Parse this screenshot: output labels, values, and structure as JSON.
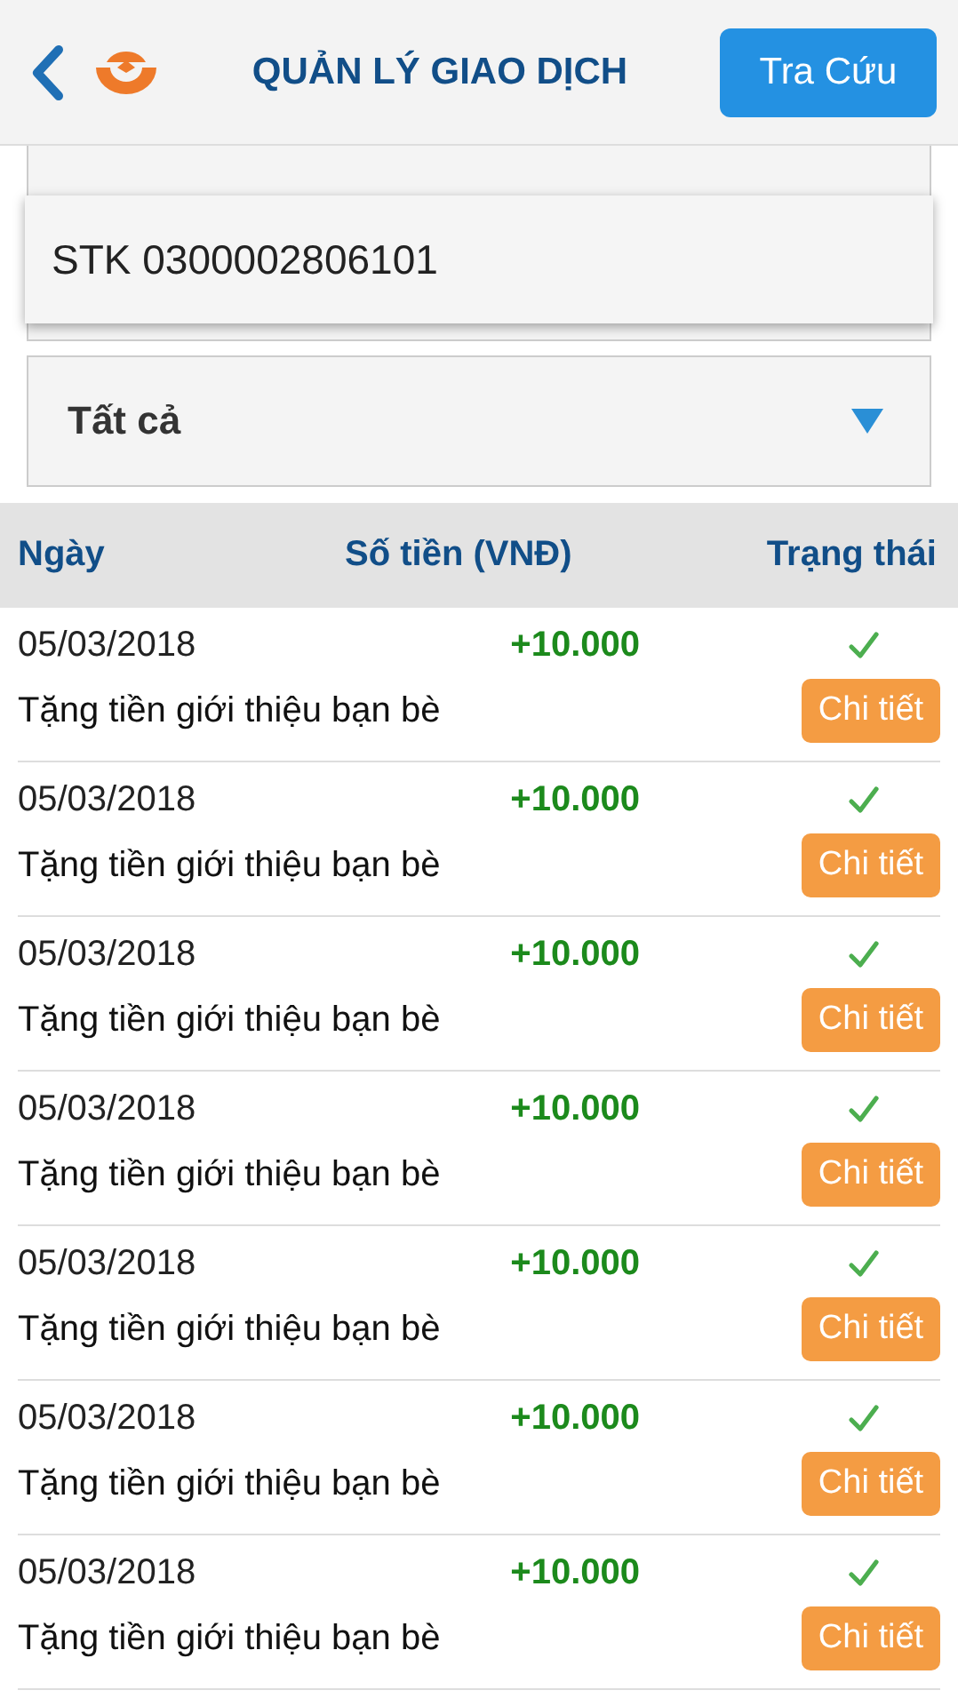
{
  "header": {
    "title": "QUẢN LÝ GIAO DỊCH",
    "search_button": "Tra Cứu"
  },
  "account_popup": {
    "value": "STK 0300002806101"
  },
  "filter": {
    "value": "Tất cả"
  },
  "table": {
    "columns": [
      "Ngày",
      "Số tiền (VNĐ)",
      "Trạng thái"
    ],
    "rows": [
      {
        "date": "05/03/2018",
        "amount": "+10.000",
        "description": "Tặng tiền giới thiệu bạn bè",
        "completed": true,
        "action": "Chi tiết"
      },
      {
        "date": "05/03/2018",
        "amount": "+10.000",
        "description": "Tặng tiền giới thiệu bạn bè",
        "completed": true,
        "action": "Chi tiết"
      },
      {
        "date": "05/03/2018",
        "amount": "+10.000",
        "description": "Tặng tiền giới thiệu bạn bè",
        "completed": true,
        "action": "Chi tiết"
      },
      {
        "date": "05/03/2018",
        "amount": "+10.000",
        "description": "Tặng tiền giới thiệu bạn bè",
        "completed": true,
        "action": "Chi tiết"
      },
      {
        "date": "05/03/2018",
        "amount": "+10.000",
        "description": "Tặng tiền giới thiệu bạn bè",
        "completed": true,
        "action": "Chi tiết"
      },
      {
        "date": "05/03/2018",
        "amount": "+10.000",
        "description": "Tặng tiền giới thiệu bạn bè",
        "completed": true,
        "action": "Chi tiết"
      },
      {
        "date": "05/03/2018",
        "amount": "+10.000",
        "description": "Tặng tiền giới thiệu bạn bè",
        "completed": true,
        "action": "Chi tiết"
      }
    ]
  }
}
